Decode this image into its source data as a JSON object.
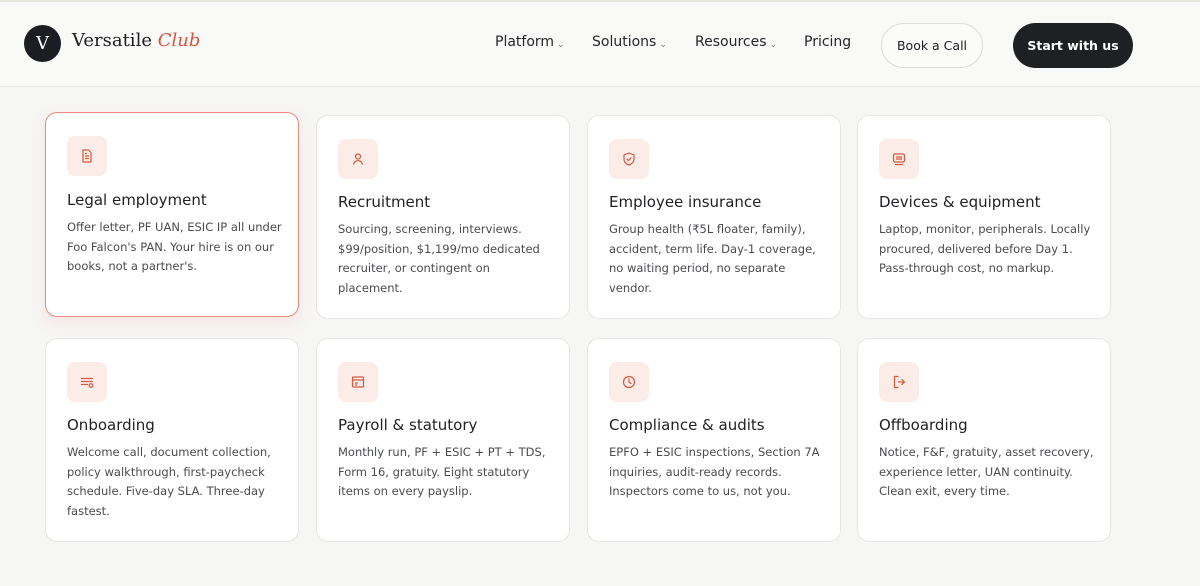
{
  "brand": {
    "mark": "V",
    "name_primary": "Versatile",
    "name_accent": "Club",
    "accent_color": "#d4573e"
  },
  "nav": {
    "items": [
      {
        "label": "Platform",
        "has_dropdown": true
      },
      {
        "label": "Solutions",
        "has_dropdown": true
      },
      {
        "label": "Resources",
        "has_dropdown": true
      },
      {
        "label": "Pricing",
        "has_dropdown": false
      }
    ],
    "chevron": "⌄",
    "book_label": "Book a Call",
    "start_label": "Start with us"
  },
  "cards": [
    {
      "title": "Legal employment",
      "icon": "document-icon",
      "active": true,
      "description": "Offer letter, PF UAN, ESIC IP all under Foo Falcon's PAN. Your hire is on our books, not a partner's."
    },
    {
      "title": "Recruitment",
      "icon": "user-icon",
      "active": false,
      "description": "Sourcing, screening, interviews. $99/position, $1,199/mo dedicated recruiter, or contingent on placement."
    },
    {
      "title": "Employee insurance",
      "icon": "shield-check-icon",
      "active": false,
      "description": "Group health (₹5L floater, family), accident, term life. Day-1 coverage, no waiting period, no separate vendor."
    },
    {
      "title": "Devices & equipment",
      "icon": "device-icon",
      "active": false,
      "description": "Laptop, monitor, peripherals. Locally procured, delivered before Day 1. Pass-through cost, no markup."
    },
    {
      "title": "Onboarding",
      "icon": "checklist-icon",
      "active": false,
      "description": "Welcome call, document collection, policy walkthrough, first-paycheck schedule. Five-day SLA. Three-day fastest."
    },
    {
      "title": "Payroll & statutory",
      "icon": "payslip-icon",
      "active": false,
      "description": "Monthly run, PF + ESIC + PT + TDS, Form 16, gratuity. Eight statutory items on every payslip."
    },
    {
      "title": "Compliance & audits",
      "icon": "clock-icon",
      "active": false,
      "description": "EPFO + ESIC inspections, Section 7A inquiries, audit-ready records. Inspectors come to us, not you."
    },
    {
      "title": "Offboarding",
      "icon": "exit-icon",
      "active": false,
      "description": "Notice, F&F, gratuity, asset recovery, experience letter, UAN continuity. Clean exit, every time."
    }
  ]
}
